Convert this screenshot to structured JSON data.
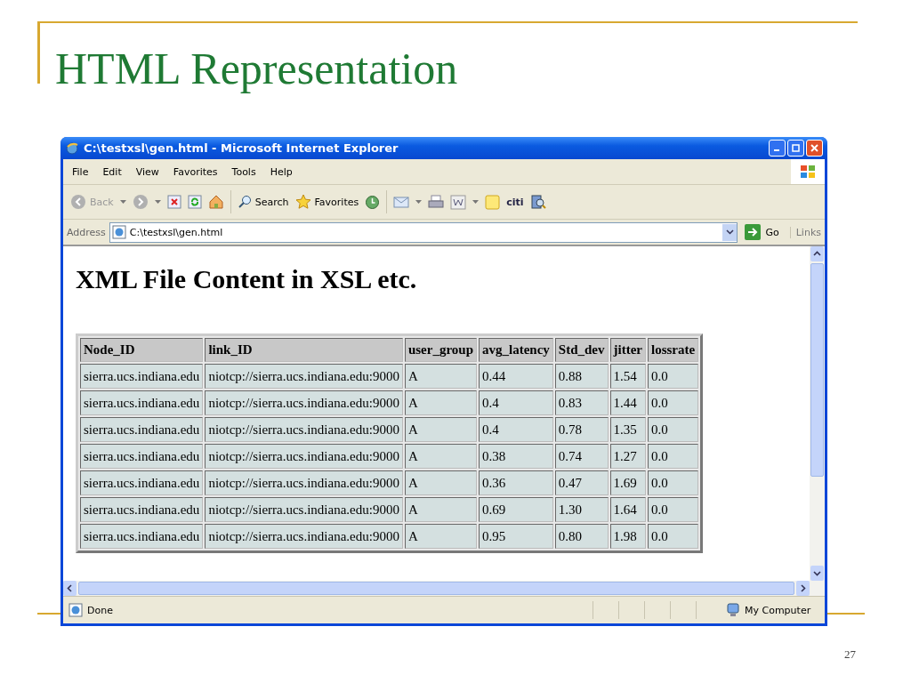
{
  "slide": {
    "title": "HTML Representation",
    "page_number": "27"
  },
  "window": {
    "title": "C:\\testxsl\\gen.html - Microsoft Internet Explorer"
  },
  "menu": [
    "File",
    "Edit",
    "View",
    "Favorites",
    "Tools",
    "Help"
  ],
  "toolbar": {
    "back": "Back",
    "search": "Search",
    "favorites": "Favorites",
    "logo_text": "citi"
  },
  "address": {
    "label": "Address",
    "value": "C:\\testxsl\\gen.html",
    "go": "Go",
    "links": "Links"
  },
  "page": {
    "heading": "XML File Content in XSL etc.",
    "table": {
      "columns": [
        "Node_ID",
        "link_ID",
        "user_group",
        "avg_latency",
        "Std_dev",
        "jitter",
        "lossrate"
      ],
      "rows": [
        [
          "sierra.ucs.indiana.edu",
          "niotcp://sierra.ucs.indiana.edu:9000",
          "A",
          "0.44",
          "0.88",
          "1.54",
          "0.0"
        ],
        [
          "sierra.ucs.indiana.edu",
          "niotcp://sierra.ucs.indiana.edu:9000",
          "A",
          "0.4",
          "0.83",
          "1.44",
          "0.0"
        ],
        [
          "sierra.ucs.indiana.edu",
          "niotcp://sierra.ucs.indiana.edu:9000",
          "A",
          "0.4",
          "0.78",
          "1.35",
          "0.0"
        ],
        [
          "sierra.ucs.indiana.edu",
          "niotcp://sierra.ucs.indiana.edu:9000",
          "A",
          "0.38",
          "0.74",
          "1.27",
          "0.0"
        ],
        [
          "sierra.ucs.indiana.edu",
          "niotcp://sierra.ucs.indiana.edu:9000",
          "A",
          "0.36",
          "0.47",
          "1.69",
          "0.0"
        ],
        [
          "sierra.ucs.indiana.edu",
          "niotcp://sierra.ucs.indiana.edu:9000",
          "A",
          "0.69",
          "1.30",
          "1.64",
          "0.0"
        ],
        [
          "sierra.ucs.indiana.edu",
          "niotcp://sierra.ucs.indiana.edu:9000",
          "A",
          "0.95",
          "0.80",
          "1.98",
          "0.0"
        ]
      ]
    }
  },
  "status_bar": {
    "text": "Done",
    "zone": "My Computer"
  }
}
